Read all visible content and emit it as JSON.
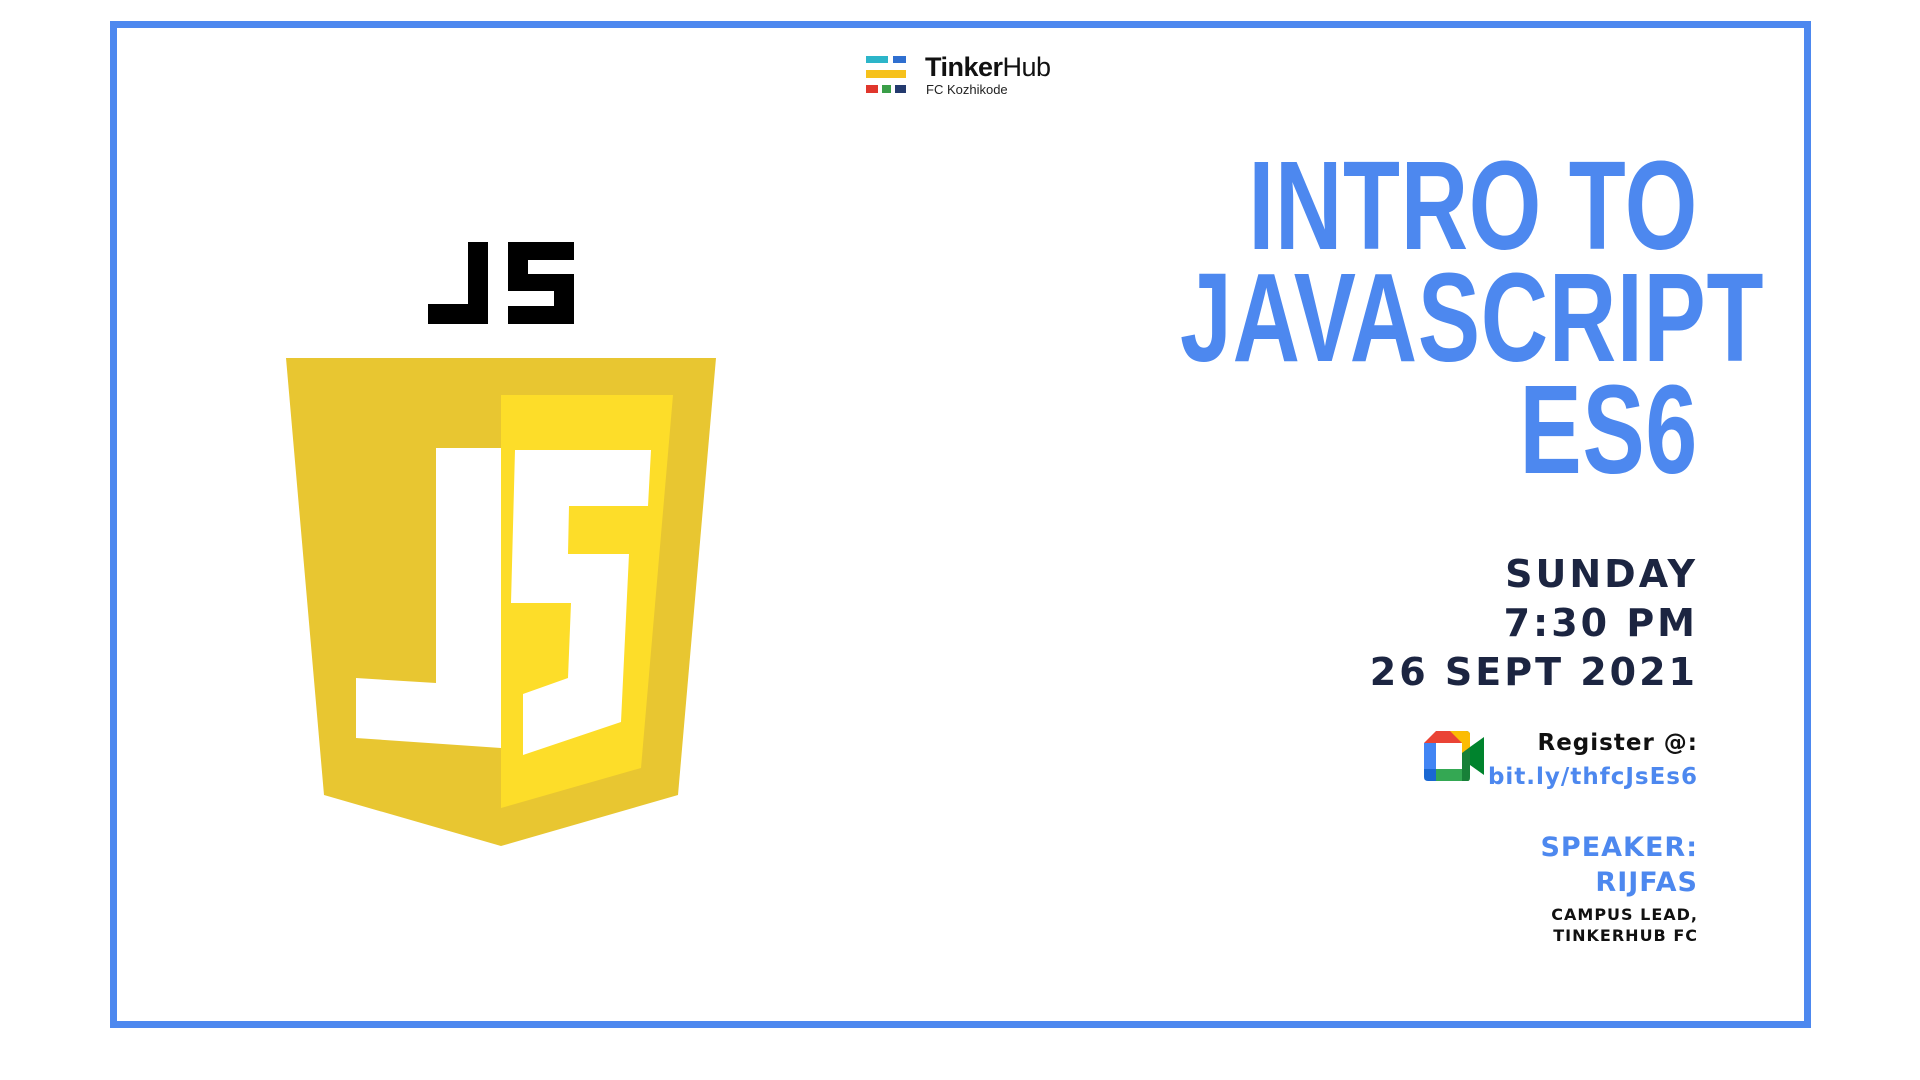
{
  "brand": {
    "name_bold": "Tinker",
    "name_regular": "Hub",
    "subtitle": "FC Kozhikode",
    "icon": "tinkerhub-logo"
  },
  "logo": {
    "wordmark_icon": "js-wordmark-icon",
    "shield_icon": "js-shield-logo",
    "colors": {
      "shield_dark": "#e8c631",
      "shield_light": "#fddd29",
      "letters": "#ffffff",
      "wordmark": "#000000"
    }
  },
  "title": {
    "line1": "INTRO TO",
    "line2": "JAVASCRIPT",
    "line3": "ES6"
  },
  "event": {
    "day": "SUNDAY",
    "time": "7:30 PM",
    "date": "26 SEPT 2021"
  },
  "register": {
    "label": "Register @:",
    "link": "bit.ly/thfcJsEs6",
    "icon": "google-meet-icon"
  },
  "speaker": {
    "label": "SPEAKER:",
    "name": "RIJFAS",
    "role_line1": "CAMPUS LEAD,",
    "role_line2": "TINKERHUB FC"
  },
  "colors": {
    "accent": "#4d88ef",
    "navy": "#1c2541",
    "background": "#ffffff"
  }
}
